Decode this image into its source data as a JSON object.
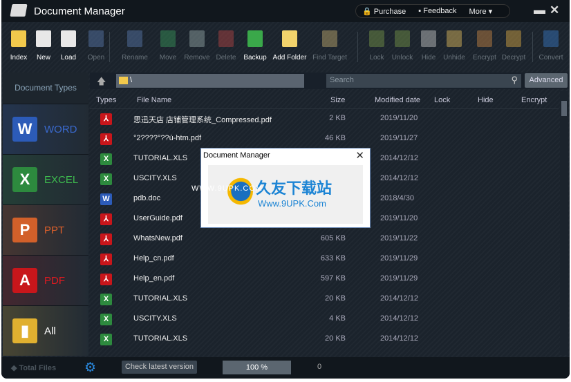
{
  "app": {
    "title": "Document Manager"
  },
  "header": {
    "purchase": "Purchase",
    "feedback": "Feedback",
    "more": "More ▾",
    "minimize": "▬",
    "close": "✕"
  },
  "toolbar": [
    {
      "label": "Index",
      "enabled": true,
      "color": "#f2c94c"
    },
    {
      "label": "New",
      "enabled": true,
      "color": "#e8e8e8"
    },
    {
      "label": "Load",
      "enabled": true,
      "color": "#e8e8e8"
    },
    {
      "label": "Open",
      "enabled": false,
      "color": "#5b7bb0"
    },
    {
      "label": "Rename",
      "enabled": false,
      "color": "#5b7bb0"
    },
    {
      "label": "Move",
      "enabled": false,
      "color": "#3a9a5b"
    },
    {
      "label": "Remove",
      "enabled": false,
      "color": "#9aa"
    },
    {
      "label": "Delete",
      "enabled": false,
      "color": "#b44"
    },
    {
      "label": "Backup",
      "enabled": true,
      "color": "#3aa84a"
    },
    {
      "label": "Add Folder",
      "enabled": true,
      "color": "#f2d36c"
    },
    {
      "label": "Find Target",
      "enabled": false,
      "color": "#c8b070"
    },
    {
      "label": "Lock",
      "enabled": false,
      "color": "#7a9a4a"
    },
    {
      "label": "Unlock",
      "enabled": false,
      "color": "#7a9a4a"
    },
    {
      "label": "Hide",
      "enabled": false,
      "color": "#ccc"
    },
    {
      "label": "Unhide",
      "enabled": false,
      "color": "#e8c060"
    },
    {
      "label": "Encrypt",
      "enabled": false,
      "color": "#c84"
    },
    {
      "label": "Decrypt",
      "enabled": false,
      "color": "#da4"
    },
    {
      "label": "Convert",
      "enabled": false,
      "color": "#3a7ac8"
    }
  ],
  "sidebar": {
    "heading": "Document Types",
    "items": [
      {
        "label": "WORD",
        "glyph": "W",
        "color": "#2c5bb8",
        "text_color": "#3a6ad0"
      },
      {
        "label": "EXCEL",
        "glyph": "X",
        "color": "#2d8a3e",
        "text_color": "#3dba4e"
      },
      {
        "label": "PPT",
        "glyph": "P",
        "color": "#d2602a",
        "text_color": "#e0602a"
      },
      {
        "label": "PDF",
        "glyph": "A",
        "color": "#c8161b",
        "text_color": "#e01a20"
      },
      {
        "label": "All",
        "glyph": "▮",
        "color": "#e0b030",
        "text_color": "#fff"
      }
    ]
  },
  "pathbar": {
    "path": "\\",
    "search_placeholder": "Search",
    "advanced": "Advanced"
  },
  "columns": [
    "Types",
    "File Name",
    "Size",
    "Modified date",
    "Lock",
    "Hide",
    "Encrypt"
  ],
  "files": [
    {
      "type": "pdf",
      "name": "思迅天店 店铺管理系统_Compressed.pdf",
      "size": "2 KB",
      "date": "2019/11/20"
    },
    {
      "type": "pdf",
      "name": "°2????°??ú-htm.pdf",
      "size": "46 KB",
      "date": "2019/11/27"
    },
    {
      "type": "xls",
      "name": "TUTORIAL.XLS",
      "size": "",
      "date": "2014/12/12"
    },
    {
      "type": "xls",
      "name": "USCITY.XLS",
      "size": "",
      "date": "2014/12/12"
    },
    {
      "type": "doc",
      "name": "pdb.doc",
      "size": "",
      "date": "2018/4/30"
    },
    {
      "type": "pdf",
      "name": "UserGuide.pdf",
      "size": "",
      "date": "2019/11/20"
    },
    {
      "type": "pdf",
      "name": "WhatsNew.pdf",
      "size": "605 KB",
      "date": "2019/11/22"
    },
    {
      "type": "pdf",
      "name": "Help_cn.pdf",
      "size": "633 KB",
      "date": "2019/11/29"
    },
    {
      "type": "pdf",
      "name": "Help_en.pdf",
      "size": "597 KB",
      "date": "2019/11/29"
    },
    {
      "type": "xls",
      "name": "TUTORIAL.XLS",
      "size": "20 KB",
      "date": "2014/12/12"
    },
    {
      "type": "xls",
      "name": "USCITY.XLS",
      "size": "4 KB",
      "date": "2014/12/12"
    },
    {
      "type": "xls",
      "name": "TUTORIAL.XLS",
      "size": "20 KB",
      "date": "2014/12/12"
    }
  ],
  "footer": {
    "total_files": "Total Files",
    "check_version": "Check latest version",
    "progress": "100 %",
    "progress_value": 100,
    "count": "0"
  },
  "dialog": {
    "title": "Document Manager",
    "close": "✕"
  },
  "watermark": {
    "text": "久友下载站",
    "url": "Www.9UPK.Com",
    "side": "WWW.9UPK.COM"
  }
}
